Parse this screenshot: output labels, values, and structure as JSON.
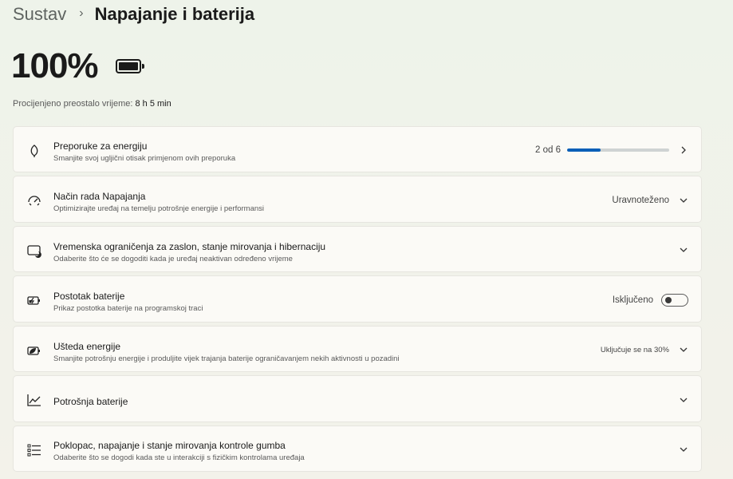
{
  "breadcrumb": {
    "parent": "Sustav",
    "separator": "›",
    "current": "Napajanje i baterija"
  },
  "battery": {
    "percent_text": "100%",
    "level": 1.0
  },
  "estimate": {
    "label": "Procijenjeno preostalo vrijeme:",
    "value": "8 h 5 min"
  },
  "cards": [
    {
      "title": "Preporuke za energiju",
      "subtitle": "Smanjite svoj ugljični otisak primjenom ovih preporuka",
      "status": "2 od 6",
      "progress": 0.33,
      "icon": "leaf-icon",
      "control": "chevron-right"
    },
    {
      "title": "Način rada Napajanja",
      "subtitle": "Optimizirajte uređaj na temelju potrošnje energije i performansi",
      "status": "Uravnoteženo",
      "icon": "speedometer-icon",
      "control": "chevron-down"
    },
    {
      "title": "Vremenska ograničenja za zaslon, stanje mirovanja i hibernaciju",
      "subtitle": "Odaberite što će se dogoditi kada je uređaj neaktivan određeno vrijeme",
      "icon": "screen-sleep-icon",
      "control": "chevron-down"
    },
    {
      "title": "Postotak baterije",
      "subtitle": "Prikaz postotka baterije na programskoj traci",
      "status": "Isključeno",
      "toggle_on": false,
      "icon": "battery-charging-icon",
      "control": "toggle"
    },
    {
      "title": "Ušteda energije",
      "subtitle": "Smanjite potrošnju energije i produljite vijek trajanja baterije ograničavanjem nekih aktivnosti u pozadini",
      "status": "Uključuje se na 30%",
      "icon": "battery-saver-icon",
      "control": "chevron-down"
    },
    {
      "title": "Potrošnja baterije",
      "icon": "line-chart-icon",
      "control": "chevron-down"
    },
    {
      "title": "Poklopac, napajanje i stanje mirovanja kontrole gumba",
      "subtitle": "Odaberite što se dogodi kada ste u interakciji s fizičkim kontrolama uređaja",
      "icon": "list-icon",
      "control": "chevron-down"
    }
  ]
}
